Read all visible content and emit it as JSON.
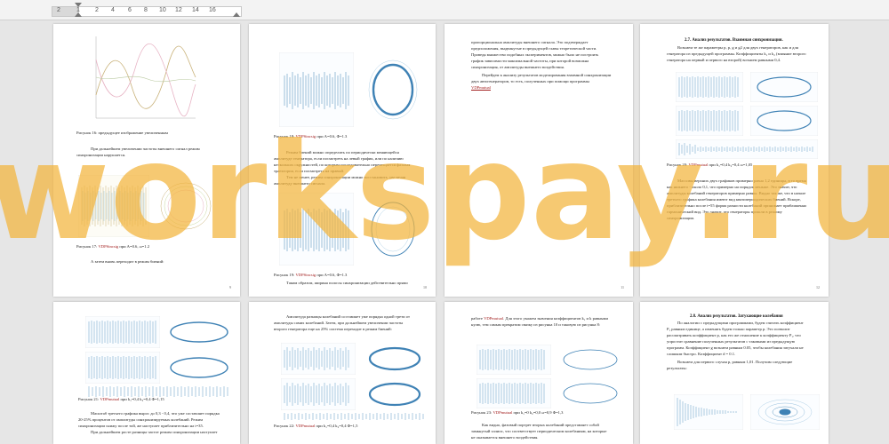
{
  "ruler": {
    "labels": [
      "2",
      "1",
      "2",
      "4",
      "6",
      "8",
      "10",
      "12",
      "14",
      "16"
    ]
  },
  "watermark": {
    "text": "workspay.ru",
    "color": "#f2b43c"
  },
  "pages": {
    "p1": {
      "cap1": "Рисунок 16: предыдущее изображение увеличенным",
      "para1a": "При дальнейшем увеличении частоты внешнего сигнал режим",
      "para1b": "синхронизации нарушается.",
      "cap2_pre": "Рисунок 17: ",
      "cap2_link": "VDPSincsig",
      "cap2_post": " при A=0.6, ω=1.2",
      "para2": "А затем вновь переходит в режим биений:",
      "num": "9"
    },
    "p2": {
      "cap1_pre": "Рисунок 18: ",
      "cap1_link": "VDPSincsig",
      "cap1_post": " при A=0.6, Φ=1.3",
      "para1a": "Режим биений можно определить по периодически меняющейся",
      "para1b": "амплитуде генератора, если посмотреть на левый график, или по наличию",
      "para1c": "нескольких окружностей, по которым последовательно перемещается фазовая",
      "para1d": "траектория, если посмотреть на правый.",
      "para1e": "Тем не менее, режим синхронизации можно восстановить, увеличив",
      "para1f": "амплитуду внешнего сигнала.",
      "cap2_pre": "Рисунок 19: ",
      "cap2_link": "VDPSincsig",
      "cap2_post": " при A=0.6, Φ=1.3",
      "para2": "Таким образом, ширина полосы синхронизации действительно прямо",
      "num": "10"
    },
    "p3": {
      "l1": "пропорциональна амплитуды внешнего сигнала. Это подтверждает",
      "l2": "предположения, выдвинутые в предыдущей главы теоретической части.",
      "l3": "Проведя множество подобных экспериментов, можно было не построить",
      "l4": "график зависимости максимальной частоты, при которой возможна",
      "l5": "синхронизация, от амплитуды внешнего воздействия.",
      "l6": "Перейдем к анализу результатов моделирования взаимной синхронизации",
      "l7": "двух автогенераторов, то есть, полученных при помощи программы",
      "link": "VDPmutual",
      "num": "11"
    },
    "p4": {
      "head": "2.7.  Анализ результатов. Взаимная синхронизация.",
      "l1": "Возьмем те же параметры р, р, g и g2 для двух генераторов, как и для",
      "l2": "генератора из предыдущей программы. Коэффициенты k₁ и k₂ (влияние второго",
      "l3": "генератора на первый и первого на второй) возьмем равными 0,4.",
      "cap_pre": "Рисунок 20: ",
      "cap_link": "VDPmutual",
      "cap_post": " при k₁=0,4 k₂=0,4 ω=1,05",
      "m1": "Массивы верхних двух графиков примерно равна 1,2 единицы, в то время",
      "m2": "как нижнего - около 0,1, что примерно на порядок меньше. Это значит, что",
      "m3": "амплитуды колебаний генераторов примерно равны. Видно так же, что в начале",
      "m4": "третьего графика колебания имеют вид квазипериодических биений. Вскоре,",
      "m5": "приблизительно после t=55 форма разности колебаний принимает приближенно",
      "m6": "гармонический вид. Это значит, что генераторы пришли в режиму",
      "m7": "синхронизации.",
      "num": "12"
    },
    "p5": {
      "cap_pre": "Рисунок 21: ",
      "cap_link": "VDPmutual",
      "cap_post": " при k₁=0,4 k₂=0,4 Φ=1,15",
      "l1": "Масштаб третьего графика вырос до 0,3 - 0,4, что уже составляет порядка",
      "l2": "20-25% процентов от амплитуды синхронизируемых колебаний. Режим",
      "l3": "синхронизации снижу после той, же наступает приблизительно на t=35.",
      "l4": "При дальнейшем росте разницы частот режим синхронизации наступает"
    },
    "p6": {
      "l1": "Амплитуда разницы колебаний составляет уже порядка одной трети от",
      "l2": "амплитуды самих колебаний. Затем, при дальнейшем увеличении частоты",
      "l3": "второго генератора еще на 25% система переходит в режим биений:",
      "cap_pre": "Рисунок 22: ",
      "cap_link": "VDPmutual",
      "cap_post": " при k₁=0,4 k₂=0,4 Φ=1,5"
    },
    "p7": {
      "l1_pre": "работе ",
      "l1_link": "VDPmutual",
      "l1_post": ". Для этого укажем значения коэффициентов k₁ и k равными",
      "l2": "нулю, тем самым прекратим связку из рисунка 10 и таковую из рисунка 8:",
      "cap_pre": "Рисунок 23: ",
      "cap_link": "VDPmutual",
      "cap_post": " при k₁=0 k₂=0,0 ω=0,9 Φ=1,3",
      "l3": "Как видно, фазовый портрет вторых колебаний представляет собой",
      "l4": "замкнутый эллипс, что соответствует периодическим колебаниям, на которые",
      "l5": "не оказывается внешнего воздействия."
    },
    "p8": {
      "head": "2.8.  Анализ результатов. Затухающие колебания",
      "l1": "По аналогии с предыдущими программами, будем считать коэффициент",
      "l2": "Р₁ равным единице, а изменять будем только параметр p. Это позволит",
      "l3": "рассматривать коэффициент p, как его же отношение к коэффициенту Р₁, что",
      "l4": "упростит сравнение полученных результатов с таковыми из предыдущую",
      "l5": "программ. Коэффициент g возьмем равным 0.05, чтобы колебания затухали не",
      "l6": "слишком быстро. Коэффициент d = 0.1.",
      "l7": "Возьмем для первого случая p, равным 1,01. Получим следующие",
      "l8": "результаты:"
    }
  }
}
